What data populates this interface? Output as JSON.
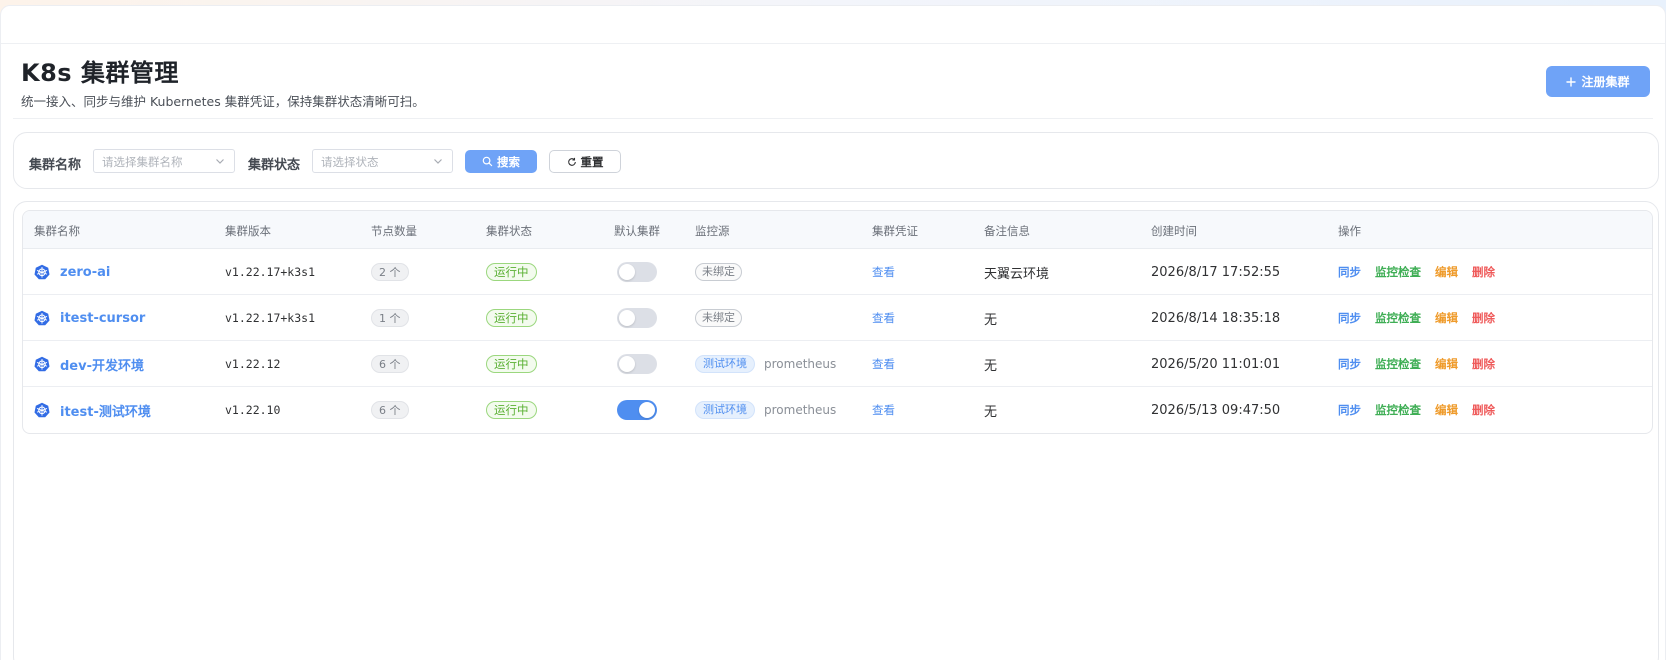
{
  "page": {
    "title": "K8s 集群管理",
    "subtitle": "统一接入、同步与维护 Kubernetes 集群凭证，保持集群状态清晰可扫。",
    "register_button": "注册集群"
  },
  "filters": {
    "name_label": "集群名称",
    "name_placeholder": "请选择集群名称",
    "status_label": "集群状态",
    "status_placeholder": "请选择状态",
    "search_button": "搜索",
    "reset_button": "重置"
  },
  "table": {
    "columns": [
      "集群名称",
      "集群版本",
      "节点数量",
      "集群状态",
      "默认集群",
      "监控源",
      "集群凭证",
      "备注信息",
      "创建时间",
      "操作"
    ],
    "rows": [
      {
        "name": "zero-ai",
        "version": "v1.22.17+k3s1",
        "nodes": "2 个",
        "status": "运行中",
        "is_default": false,
        "monitor_tag": "未绑定",
        "monitor_source": "",
        "credential": "查看",
        "remark": "天翼云环境",
        "created": "2026/8/17 17:52:55"
      },
      {
        "name": "itest-cursor",
        "version": "v1.22.17+k3s1",
        "nodes": "1 个",
        "status": "运行中",
        "is_default": false,
        "monitor_tag": "未绑定",
        "monitor_source": "",
        "credential": "查看",
        "remark": "无",
        "created": "2026/8/14 18:35:18"
      },
      {
        "name": "dev-开发环境",
        "version": "v1.22.12",
        "nodes": "6 个",
        "status": "运行中",
        "is_default": false,
        "monitor_tag": "测试环境",
        "monitor_source": "prometheus",
        "credential": "查看",
        "remark": "无",
        "created": "2026/5/20 11:01:01"
      },
      {
        "name": "itest-测试环境",
        "version": "v1.22.10",
        "nodes": "6 个",
        "status": "运行中",
        "is_default": true,
        "monitor_tag": "测试环境",
        "monitor_source": "prometheus",
        "credential": "查看",
        "remark": "无",
        "created": "2026/5/13 09:47:50"
      }
    ],
    "actions": {
      "sync": "同步",
      "monitor_check": "监控检查",
      "edit": "编辑",
      "delete": "删除"
    }
  },
  "colors": {
    "accent": "#4f8ef0",
    "button_primary": "#6fa3f7",
    "success": "#5ab033",
    "warning": "#ef9b2b",
    "danger": "#ef5b5b",
    "monitor_green": "#3fae55"
  },
  "icons": {
    "cluster_icon": "kubernetes-icon",
    "add_icon": "plus-icon",
    "search_icon": "search-icon",
    "reset_icon": "refresh-icon",
    "dropdown_icon": "chevron-down-icon"
  }
}
